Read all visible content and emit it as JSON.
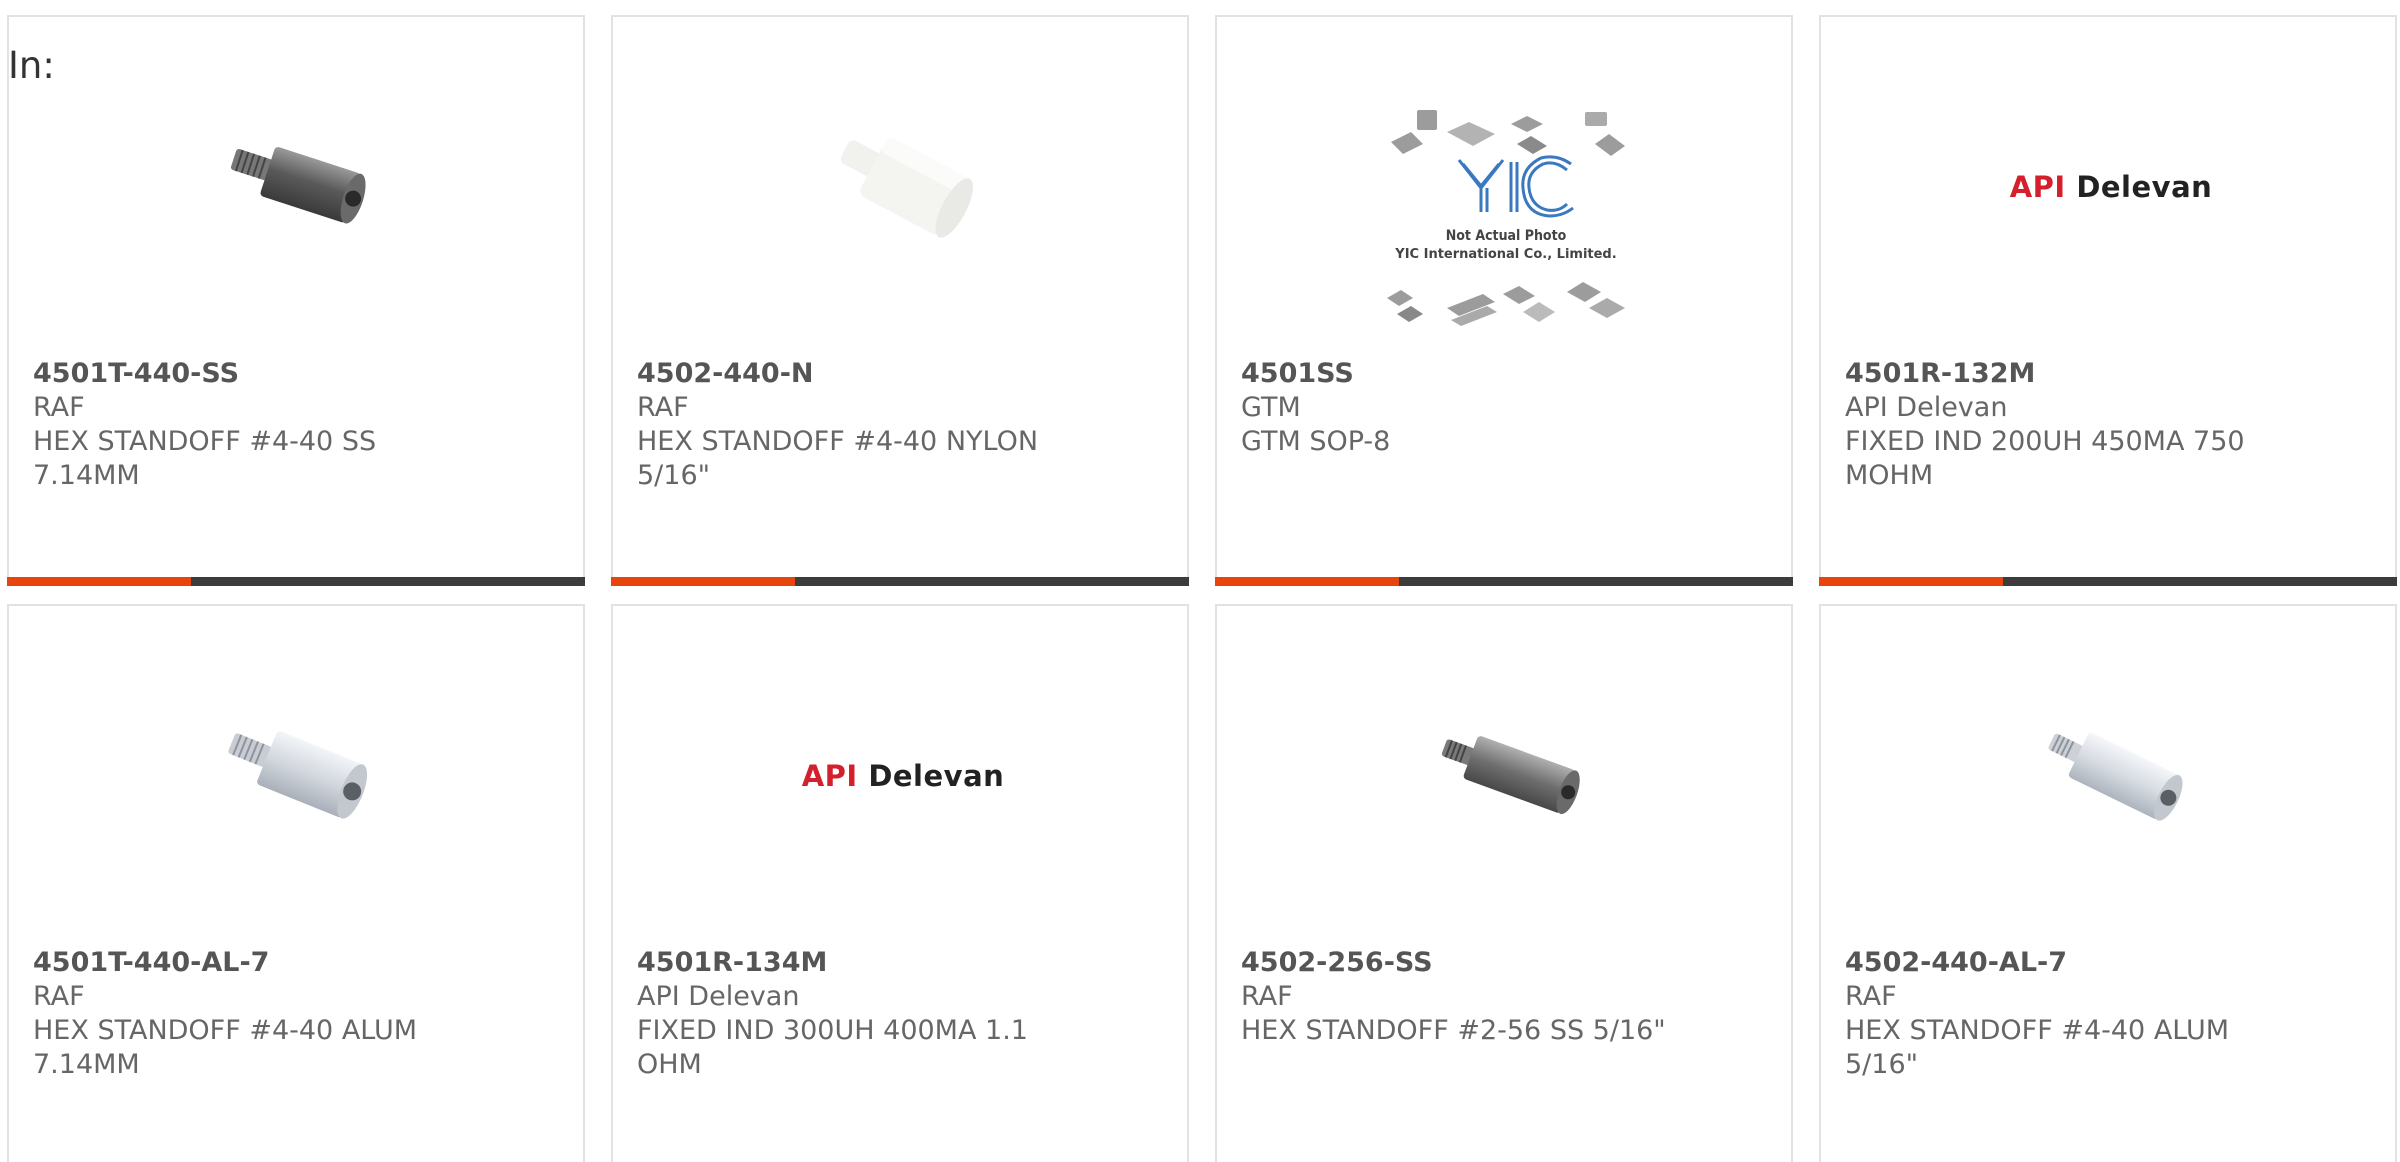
{
  "header": {
    "in_label": "In:"
  },
  "colors": {
    "accent": "#e8440e",
    "bar": "#3c3c3c",
    "card_border": "#e2e2e2",
    "api_red": "#d4202c"
  },
  "products": [
    {
      "part_number": "4501T-440-SS",
      "manufacturer": "RAF",
      "description": "HEX STANDOFF #4-40 SS 7.14MM",
      "image": "steel-standoff-icon"
    },
    {
      "part_number": "4502-440-N",
      "manufacturer": "RAF",
      "description": "HEX STANDOFF #4-40 NYLON 5/16\"",
      "image": "nylon-standoff-icon"
    },
    {
      "part_number": "4501SS",
      "manufacturer": "GTM",
      "description": "GTM SOP-8",
      "image": "placeholder-photo-icon",
      "image_text": {
        "logo": "YIC",
        "line1": "Not Actual Photo",
        "line2": "YIC International Co., Limited."
      }
    },
    {
      "part_number": "4501R-132M",
      "manufacturer": "API Delevan",
      "description": "FIXED IND 200UH 450MA 750 MOHM",
      "image": "api-delevan-logo",
      "logo": {
        "word1": "API",
        "word2": "Delevan"
      }
    },
    {
      "part_number": "4501T-440-AL-7",
      "manufacturer": "RAF",
      "description": "HEX STANDOFF #4-40 ALUM 7.14MM",
      "image": "aluminum-standoff-icon"
    },
    {
      "part_number": "4501R-134M",
      "manufacturer": "API Delevan",
      "description": "FIXED IND 300UH 400MA 1.1 OHM",
      "image": "api-delevan-logo",
      "logo": {
        "word1": "API",
        "word2": "Delevan"
      }
    },
    {
      "part_number": "4502-256-SS",
      "manufacturer": "RAF",
      "description": "HEX STANDOFF #2-56 SS 5/16\"",
      "image": "steel-standoff-icon"
    },
    {
      "part_number": "4502-440-AL-7",
      "manufacturer": "RAF",
      "description": "HEX STANDOFF #4-40 ALUM 5/16\"",
      "image": "aluminum-standoff-icon"
    }
  ]
}
